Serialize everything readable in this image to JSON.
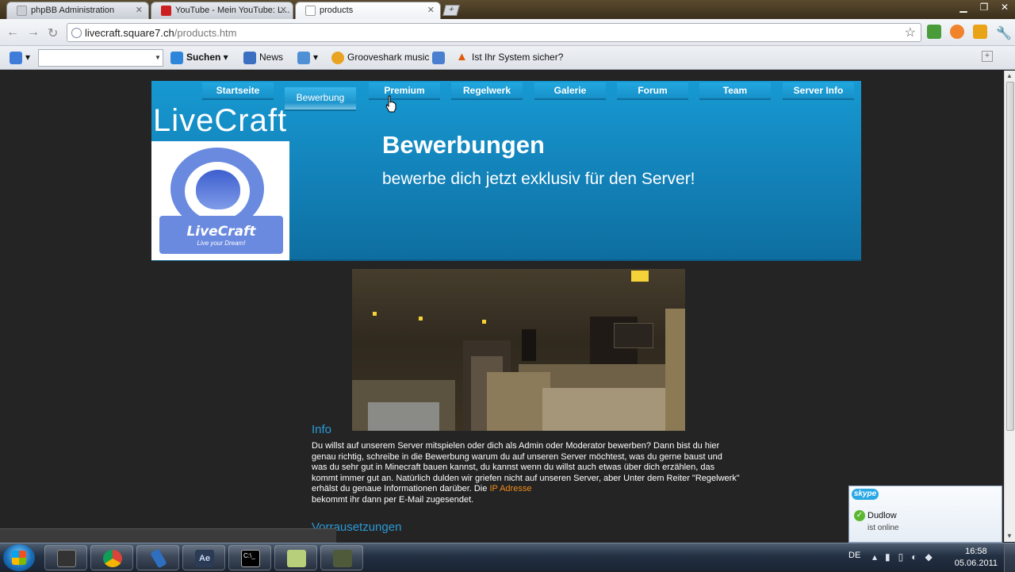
{
  "browser": {
    "tabs": [
      {
        "title": "phpBB Administration",
        "active": false
      },
      {
        "title": "YouTube - Mein YouTube: L...",
        "active": false
      },
      {
        "title": "products",
        "active": true
      }
    ],
    "url_host": "livecraft.square7.ch",
    "url_path": "/products.htm"
  },
  "bookmarks": {
    "search_label": "Suchen",
    "news_label": "News",
    "grooveshark_label": "Grooveshark music",
    "security_label": "Ist Ihr System sicher?"
  },
  "site": {
    "nav": [
      "Startseite",
      "Bewerbung",
      "Premium",
      "Regelwerk",
      "Galerie",
      "Forum",
      "Team",
      "Server Info"
    ],
    "active_nav": "Bewerbung",
    "brand": "LiveCraft",
    "logo_name": "LiveCraft",
    "logo_tagline": "Live your Dream!",
    "heading": "Bewerbungen",
    "subheading": "bewerbe dich jetzt exklusiv für den Server!",
    "info_title": "Info",
    "info_text": "Du willst auf unserem Server mitspielen oder dich als Admin oder Moderator bewerben? Dann bist du hier genau richtig, schreibe in die Bewerbung warum du auf unseren Server möchtest, was du gerne baust und was du sehr gut in Minecraft bauen kannst, du kannst wenn du willst auch etwas über dich erzählen, das kommt immer gut an. Natürlich dulden wir griefen nicht auf unseren Server, aber Unter dem Reiter \"Regelwerk\" erhälst du genaue Informationen darüber. Die",
    "info_link": "IP Adresse",
    "info_text_end": "bekommt ihr dann per E-Mail zugesendet.",
    "requirements_title": "Vorrausetzungen"
  },
  "skype": {
    "brand": "skype",
    "contact": "Dudlow",
    "status": "ist online"
  },
  "taskbar": {
    "language": "DE",
    "time": "16:58",
    "date": "05.06.2011",
    "app_icons": [
      "media-player-icon",
      "chrome-icon",
      "pen-icon",
      "after-effects-icon",
      "terminal-icon",
      "notes-icon",
      "archive-icon"
    ]
  },
  "colors": {
    "header_blue": "#1799d2",
    "link_orange": "#f08c1c",
    "section_title_blue": "#2b9ad8"
  }
}
